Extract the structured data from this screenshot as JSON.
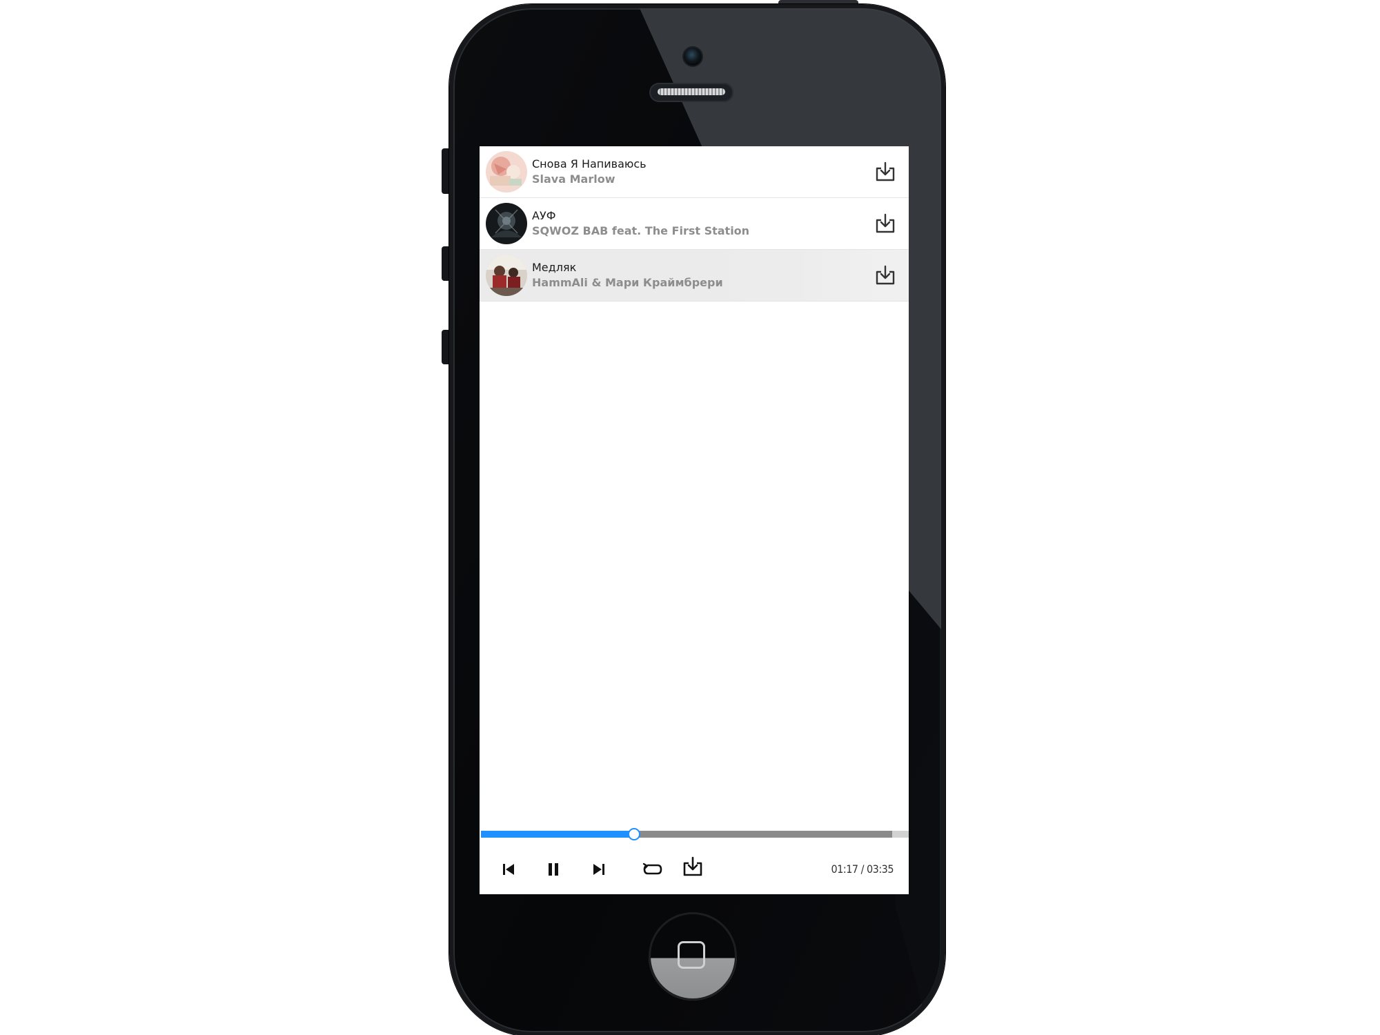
{
  "playlist": {
    "tracks": [
      {
        "title": "Снова Я Напиваюсь",
        "artist": "Slava Marlow",
        "active": false,
        "cover_icon": "album-cover"
      },
      {
        "title": "АУФ",
        "artist": "SQWOZ BAB feat. The First Station",
        "active": false,
        "cover_icon": "album-cover"
      },
      {
        "title": "Медляк",
        "artist": "HammAli & Мари Краймбрери",
        "active": true,
        "cover_icon": "album-cover"
      }
    ],
    "row_action_icon": "download-icon"
  },
  "player": {
    "current_time": "01:17",
    "duration": "03:35",
    "time_display": "01:17 / 03:35",
    "progress_fraction": 0.3581,
    "controls": {
      "previous_icon": "skip-previous-icon",
      "pause_icon": "pause-icon",
      "next_icon": "skip-next-icon",
      "repeat_icon": "repeat-icon",
      "download_icon": "download-icon"
    }
  },
  "colors": {
    "accent": "#1e90ff",
    "progress_track": "#8a8a8a",
    "active_row": "#ebebeb",
    "artist_text": "#8d8d8d",
    "title_text": "#1a1a1a",
    "phone_body": "#07080a"
  }
}
